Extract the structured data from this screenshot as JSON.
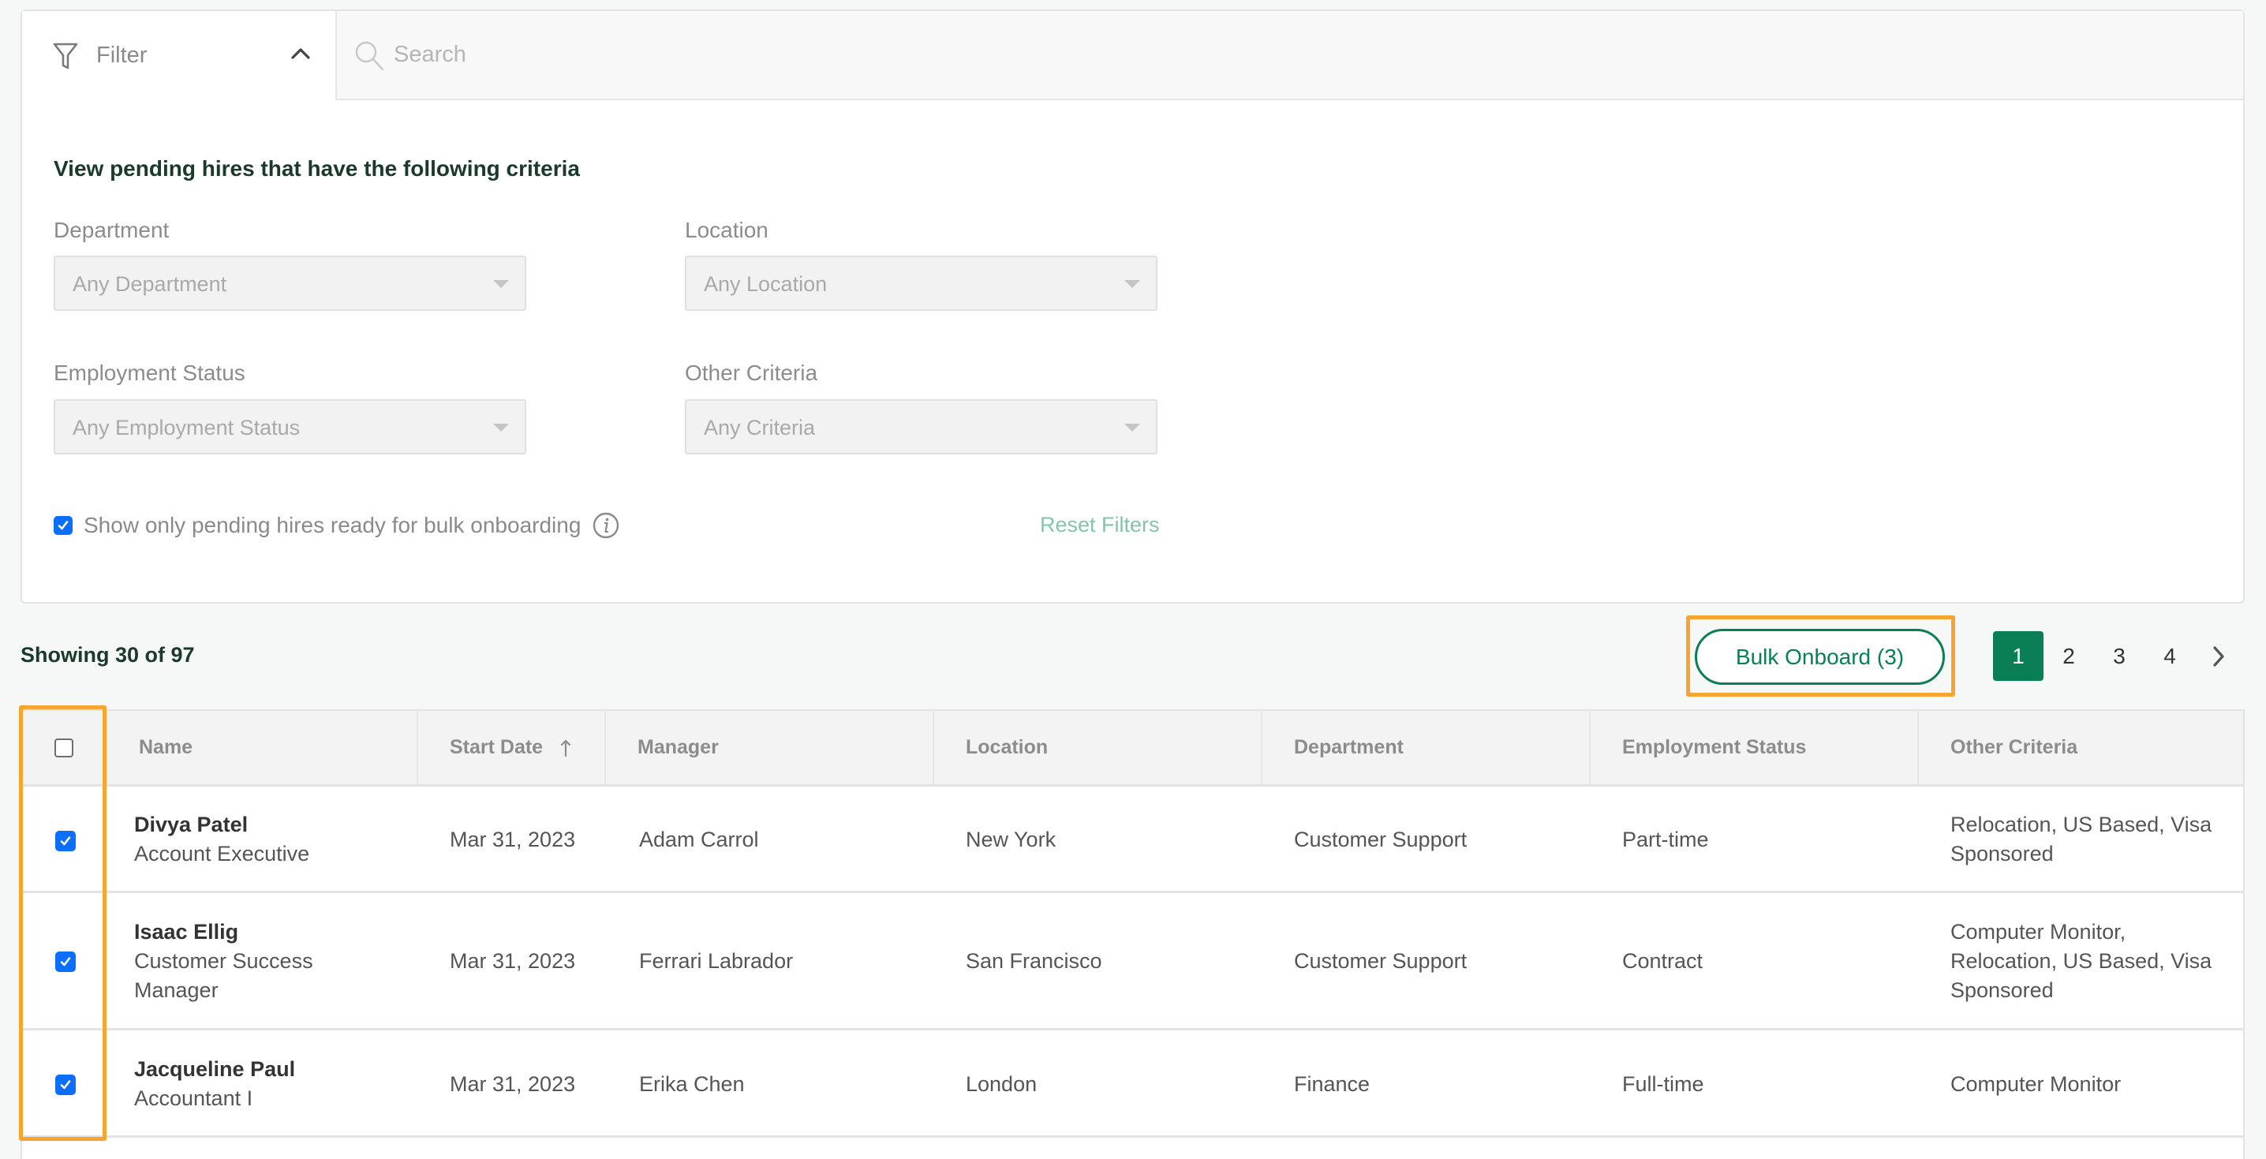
{
  "filter": {
    "tab_label": "Filter",
    "search_placeholder": "Search",
    "heading": "View pending hires that have the following criteria",
    "fields": {
      "department": {
        "label": "Department",
        "value": "Any Department"
      },
      "location": {
        "label": "Location",
        "value": "Any Location"
      },
      "employment_status": {
        "label": "Employment Status",
        "value": "Any Employment Status"
      },
      "other_criteria": {
        "label": "Other Criteria",
        "value": "Any Criteria"
      }
    },
    "bulk_ready_checkbox": {
      "label": "Show only pending hires ready for bulk onboarding",
      "checked": true
    },
    "reset_label": "Reset Filters"
  },
  "summary": {
    "showing": "Showing 30 of 97"
  },
  "actions": {
    "bulk_onboard_label": "Bulk Onboard (3)",
    "highlight_color": "#f7a531",
    "accent_color": "#0a7e55"
  },
  "pagination": {
    "pages": [
      "1",
      "2",
      "3",
      "4"
    ],
    "current": "1"
  },
  "table": {
    "columns": [
      "Name",
      "Start Date",
      "Manager",
      "Location",
      "Department",
      "Employment Status",
      "Other Criteria"
    ],
    "sort_column": "Start Date",
    "sort_direction": "ascending",
    "select_all_checked": false,
    "rows": [
      {
        "checked": true,
        "name": "Divya Patel",
        "role": "Account Executive",
        "start_date": "Mar 31, 2023",
        "manager": "Adam Carrol",
        "location": "New York",
        "department": "Customer Support",
        "employment_status": "Part-time",
        "other_criteria": "Relocation, US Based, Visa Sponsored"
      },
      {
        "checked": true,
        "name": "Isaac Ellig",
        "role": "Customer Success Manager",
        "start_date": "Mar 31, 2023",
        "manager": "Ferrari Labrador",
        "location": "San Francisco",
        "department": "Customer Support",
        "employment_status": "Contract",
        "other_criteria": "Computer Monitor, Relocation, US Based, Visa Sponsored"
      },
      {
        "checked": true,
        "name": "Jacqueline Paul",
        "role": "Accountant I",
        "start_date": "Mar 31, 2023",
        "manager": "Erika Chen",
        "location": "London",
        "department": "Finance",
        "employment_status": "Full-time",
        "other_criteria": "Computer Monitor"
      }
    ]
  }
}
